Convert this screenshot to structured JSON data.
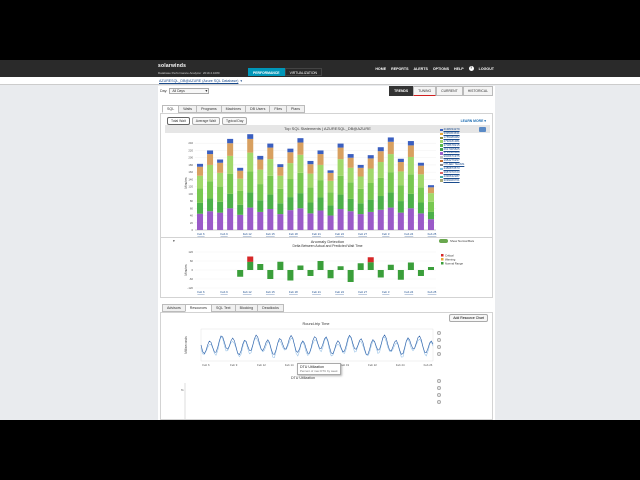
{
  "app": {
    "brand": "solarwinds",
    "product": "Database Performance Analyzer",
    "version": "2019.4.1080",
    "product_tabs": [
      "PERFORMANCE",
      "VIRTUALIZATION"
    ],
    "nav": [
      "HOME",
      "REPORTS",
      "ALERTS",
      "OPTIONS",
      "HELP",
      "LOGOUT"
    ],
    "database": "AZURESQL_DB@AZURE (Azure SQL Database)"
  },
  "toolbar": {
    "date_label": "Day:",
    "date_value": "All Days",
    "view_tabs": [
      "TRENDS",
      "TUNING",
      "CURRENT",
      "HISTORICAL"
    ]
  },
  "tabs": [
    "SQL",
    "Waits",
    "Programs",
    "Machines",
    "DB Users",
    "Files",
    "Plans"
  ],
  "subtabs": [
    "Total Wait",
    "Average Wait",
    "Typical Day"
  ],
  "learn_more": "LEARN MORE ▾",
  "top_chart": {
    "title": "Top SQL Statements  |  AZURESQL_DB@AZURE",
    "ylabel": "Minutes",
    "legend": [
      {
        "label": "4198334279",
        "color": "#3b5fc0"
      },
      {
        "label": "3395364631",
        "color": "#e8a838"
      },
      {
        "label": "1785486082",
        "color": "#8a8a3a"
      },
      {
        "label": "4792181381",
        "color": "#9fd46a"
      },
      {
        "label": "3708678215",
        "color": "#56b84e"
      },
      {
        "label": "2617005825",
        "color": "#3fa14a"
      },
      {
        "label": "1794580389",
        "color": "#a060d0"
      },
      {
        "label": "9906671975",
        "color": "#c0c0c0"
      },
      {
        "label": "1984276297",
        "color": "#c46a2a"
      },
      {
        "label": "OTHER TEAMS",
        "color": "#888888"
      },
      {
        "label": "4486873573",
        "color": "#7fc0e0"
      },
      {
        "label": "3987070723",
        "color": "#d66"
      },
      {
        "label": "4396632287",
        "color": "#4aa"
      },
      {
        "label": "3099469761",
        "color": "#aa7"
      }
    ]
  },
  "chart_data": [
    {
      "type": "bar",
      "title": "Top SQL Statements  |  AZURESQL_DB@AZURE",
      "ylabel": "Minutes",
      "ylim": [
        0,
        260
      ],
      "yticks": [
        0,
        20,
        40,
        60,
        80,
        100,
        120,
        140,
        160,
        180,
        200,
        220,
        240
      ],
      "xtick_labels": [
        "Feb 6",
        "Feb 9",
        "Feb 12",
        "Feb 15",
        "Feb 18",
        "Feb 21",
        "Feb 24",
        "Feb 27",
        "Feb 3",
        "Feb 24",
        "Feb 25"
      ],
      "stack_colors": [
        "#9a5ac8",
        "#4cb04a",
        "#78c850",
        "#a0d86a",
        "#d8a060",
        "#3b5fc0"
      ],
      "values": [
        [
          45,
          30,
          40,
          35,
          25,
          8
        ],
        [
          52,
          35,
          48,
          45,
          30,
          10
        ],
        [
          48,
          30,
          42,
          38,
          28,
          9
        ],
        [
          60,
          40,
          55,
          50,
          35,
          12
        ],
        [
          42,
          28,
          38,
          34,
          22,
          8
        ],
        [
          62,
          42,
          58,
          52,
          38,
          13
        ],
        [
          50,
          32,
          45,
          40,
          28,
          10
        ],
        [
          58,
          40,
          52,
          46,
          32,
          11
        ],
        [
          44,
          30,
          40,
          36,
          24,
          8
        ],
        [
          55,
          36,
          50,
          44,
          30,
          10
        ],
        [
          60,
          42,
          56,
          50,
          34,
          12
        ],
        [
          46,
          30,
          42,
          38,
          26,
          9
        ],
        [
          54,
          36,
          48,
          42,
          30,
          10
        ],
        [
          40,
          28,
          36,
          32,
          22,
          7
        ],
        [
          58,
          40,
          52,
          46,
          32,
          11
        ],
        [
          52,
          34,
          46,
          40,
          28,
          10
        ],
        [
          44,
          30,
          40,
          34,
          24,
          8
        ],
        [
          50,
          34,
          46,
          40,
          28,
          9
        ],
        [
          56,
          38,
          50,
          44,
          30,
          11
        ],
        [
          62,
          42,
          56,
          50,
          34,
          12
        ],
        [
          48,
          32,
          44,
          38,
          26,
          9
        ],
        [
          60,
          40,
          54,
          48,
          32,
          12
        ],
        [
          46,
          30,
          42,
          36,
          24,
          8
        ],
        [
          30,
          20,
          28,
          24,
          16,
          6
        ]
      ]
    },
    {
      "type": "bar",
      "title": "Anomaly Detection",
      "subtitle": "Delta Between Actual and Predicted Wait Time",
      "ylabel": "Minutes",
      "ylim": [
        -120,
        120
      ],
      "yticks": [
        120,
        60,
        0,
        -60,
        -120
      ],
      "xtick_labels": [
        "Feb 6",
        "Feb 9",
        "Feb 12",
        "Feb 15",
        "Feb 18",
        "Feb 21",
        "Feb 24",
        "Feb 27",
        "Feb 3",
        "Feb 24",
        "Feb 25"
      ],
      "legend": [
        "Critical",
        "Warning",
        "Normal Range"
      ],
      "values": [
        {
          "v": 0,
          "c": "n"
        },
        {
          "v": 0,
          "c": "n"
        },
        {
          "v": 0,
          "c": "n"
        },
        {
          "v": 0,
          "c": "n"
        },
        {
          "v": -45,
          "c": "n"
        },
        {
          "v": 90,
          "c": "c"
        },
        {
          "v": 40,
          "c": "n"
        },
        {
          "v": -60,
          "c": "n"
        },
        {
          "v": 55,
          "c": "n"
        },
        {
          "v": -70,
          "c": "n"
        },
        {
          "v": 30,
          "c": "n"
        },
        {
          "v": -40,
          "c": "n"
        },
        {
          "v": 60,
          "c": "n"
        },
        {
          "v": -55,
          "c": "n"
        },
        {
          "v": 25,
          "c": "n"
        },
        {
          "v": -80,
          "c": "n"
        },
        {
          "v": 45,
          "c": "n"
        },
        {
          "v": 85,
          "c": "c"
        },
        {
          "v": -50,
          "c": "n"
        },
        {
          "v": 35,
          "c": "n"
        },
        {
          "v": -65,
          "c": "n"
        },
        {
          "v": 50,
          "c": "n"
        },
        {
          "v": -40,
          "c": "n"
        },
        {
          "v": 20,
          "c": "n"
        }
      ]
    },
    {
      "type": "line",
      "title": "Round-trip Time",
      "ylabel": "Milliseconds",
      "xtick_labels": [
        "Feb 6",
        "Feb 9",
        "Feb 12",
        "Feb 14",
        "Feb 17",
        "Feb 19",
        "Feb 22",
        "Feb 24",
        "Feb 26"
      ],
      "description": "Dense oscillating series; tooltip shown"
    }
  ],
  "anomaly": {
    "title": "Anomaly Detection",
    "subtitle": "Delta Between Actual and Predicted Wait Time",
    "toggle_label": "Show Normal Bars",
    "legend": [
      "Critical",
      "Warning",
      "Normal Range"
    ]
  },
  "resource_tabs": [
    "Advisors",
    "Resources",
    "SQL Text",
    "Blocking",
    "Deadlocks"
  ],
  "add_resource_chart": "Add Resource Chart",
  "rtt_chart": {
    "title": "Round-trip Time",
    "ylabel": "Milliseconds"
  },
  "tooltip": {
    "title": "DTU Utilization",
    "sub": "Percent of max DTU by week"
  },
  "dtu_title": "DTU Utilization"
}
